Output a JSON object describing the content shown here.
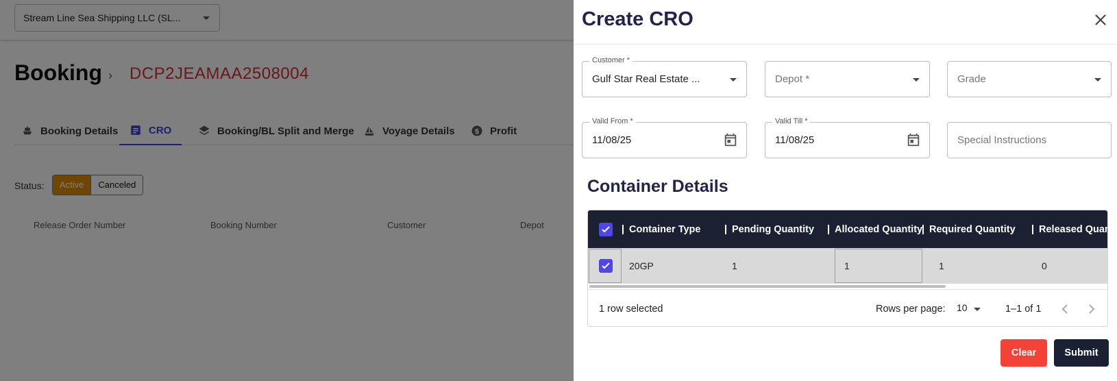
{
  "topbar": {
    "company": "Stream Line Sea Shipping LLC  (SL..."
  },
  "booking": {
    "title": "Booking",
    "number": "DCP2JEAMAA2508004"
  },
  "tabs": [
    {
      "label": "Booking Details",
      "icon": "ship-icon"
    },
    {
      "label": "CRO",
      "icon": "list-icon",
      "active": true
    },
    {
      "label": "Booking/BL Split and Merge",
      "icon": "layers-icon"
    },
    {
      "label": "Voyage Details",
      "icon": "sailboat-icon"
    },
    {
      "label": "Profit",
      "icon": "dollar-icon"
    }
  ],
  "status": {
    "label": "Status:",
    "active": "Active",
    "canceled": "Canceled"
  },
  "bg_table_headers": [
    "Release Order Number",
    "Booking Number",
    "Customer",
    "Depot"
  ],
  "drawer": {
    "title": "Create CRO",
    "customer": {
      "label": "Customer *",
      "value": "Gulf Star Real Estate ..."
    },
    "depot": {
      "placeholder": "Depot *"
    },
    "grade": {
      "placeholder": "Grade"
    },
    "valid_from": {
      "label": "Valid From *",
      "value": "11/08/25"
    },
    "valid_till": {
      "label": "Valid Till *",
      "value": "11/08/25"
    },
    "special_instructions": {
      "placeholder": "Special Instructions"
    },
    "container_details_title": "Container Details",
    "grid": {
      "columns": [
        "Container Type",
        "Pending Quantity",
        "Allocated Quantity",
        "Required Quantity",
        "Released Quan"
      ],
      "rows": [
        {
          "container_type": "20GP",
          "pending": "1",
          "allocated": "1",
          "required": "1",
          "released": "0",
          "selected": true
        }
      ],
      "footer": {
        "selected": "1 row selected",
        "rows_per_page_label": "Rows per page:",
        "rows_per_page": "10",
        "range": "1–1 of 1"
      }
    },
    "buttons": {
      "clear": "Clear",
      "submit": "Submit"
    }
  },
  "colors": {
    "accent": "#4f46e5",
    "title": "#23234d",
    "header_bg": "#1b2133",
    "danger": "#f44336",
    "booking_number": "#d32f2f",
    "status_active": "#e08a00"
  }
}
